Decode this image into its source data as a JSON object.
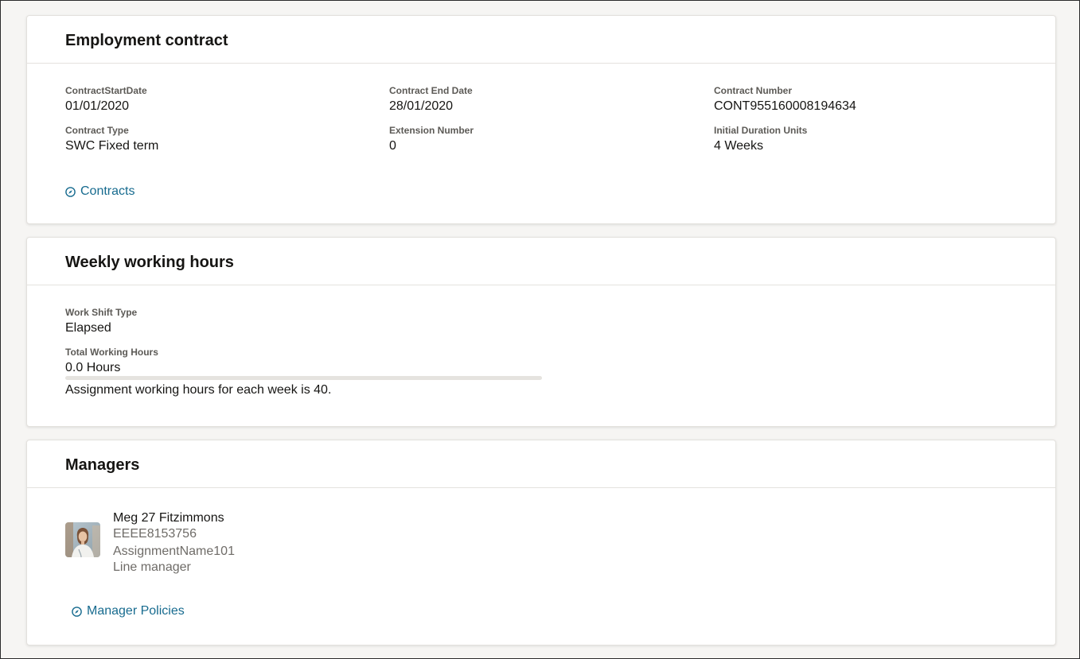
{
  "employment_contract": {
    "title": "Employment contract",
    "fields": [
      {
        "label": "ContractStartDate",
        "value": "01/01/2020"
      },
      {
        "label": "Contract End Date",
        "value": "28/01/2020"
      },
      {
        "label": "Contract Number",
        "value": "CONT955160008194634"
      },
      {
        "label": "Contract Type",
        "value": "SWC Fixed term"
      },
      {
        "label": "Extension Number",
        "value": "0"
      },
      {
        "label": "Initial Duration Units",
        "value": "4 Weeks"
      }
    ],
    "link_label": "Contracts"
  },
  "weekly_working_hours": {
    "title": "Weekly working hours",
    "work_shift_type_label": "Work Shift Type",
    "work_shift_type_value": "Elapsed",
    "total_hours_label": "Total Working Hours",
    "total_hours_value": "0.0 Hours",
    "progress_fraction": 0.0,
    "note": "Assignment working hours for each week is 40."
  },
  "managers": {
    "title": "Managers",
    "manager": {
      "name": "Meg 27 Fitzimmons",
      "person_number": "EEEE8153756",
      "assignment_name": "AssignmentName101",
      "relationship": "Line manager"
    },
    "link_label": "Manager Policies"
  },
  "colors": {
    "link": "#176b8f",
    "background": "#f6f5f3",
    "card": "#ffffff"
  },
  "icons": {
    "link_icon": "compass-icon"
  }
}
